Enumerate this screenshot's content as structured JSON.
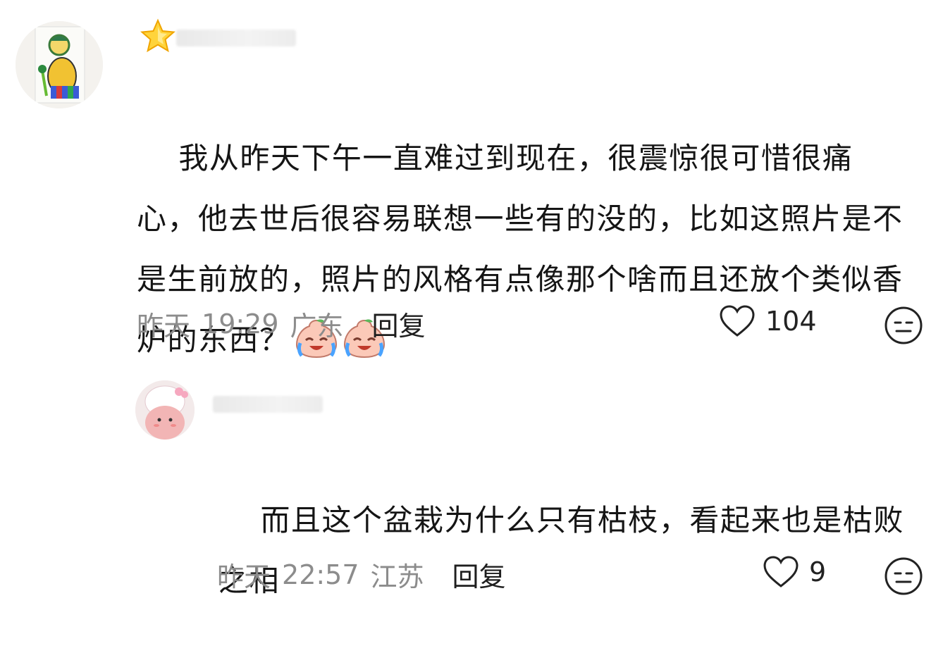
{
  "comments": [
    {
      "text": "我从昨天下午一直难过到现在，很震惊很可惜很痛心，他去世后很容易联想一些有的没的，比如这照片是不是生前放的，照片的风格有点像那个啥而且还放个类似香炉的东西？",
      "emoji": [
        "crying-laughing-peach-emoji",
        "crying-laughing-peach-emoji"
      ],
      "date": "昨天",
      "time": "19:29",
      "location": "广东",
      "reply_label": "回复",
      "likes": "104",
      "has_badge": "star-badge-icon"
    },
    {
      "text": "而且这个盆栽为什么只有枯枝，看起来也是枯败之相",
      "date": "昨天",
      "time": "22:57",
      "location": "江苏",
      "reply_label": "回复",
      "likes": "9"
    }
  ],
  "colors": {
    "text": "#151515",
    "meta": "#8c8c8c",
    "background": "#ffffff"
  }
}
